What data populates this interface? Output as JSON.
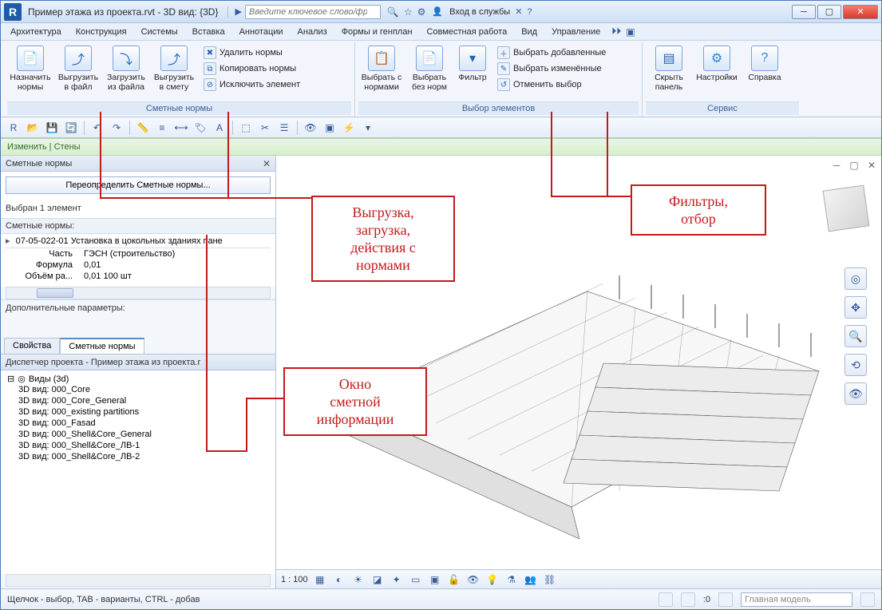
{
  "window": {
    "title": "Пример этажа из проекта.rvt - 3D вид: {3D}",
    "search_placeholder": "Введите ключевое слово/фразу",
    "signin": "Вход в службы"
  },
  "menu": [
    "Архитектура",
    "Конструкция",
    "Системы",
    "Вставка",
    "Аннотации",
    "Анализ",
    "Формы и генплан",
    "Совместная работа",
    "Вид",
    "Управление"
  ],
  "ribbon": {
    "group1": {
      "label": "Сметные нормы",
      "big": [
        {
          "label": "Назначить нормы"
        },
        {
          "label": "Выгрузить в файл"
        },
        {
          "label": "Загрузить из файла"
        },
        {
          "label": "Выгрузить в смету"
        }
      ],
      "small": [
        "Удалить  нормы",
        "Копировать  нормы",
        "Исключить  элемент"
      ]
    },
    "group2": {
      "label": "Выбор элементов",
      "big": [
        {
          "label": "Выбрать с нормами"
        },
        {
          "label": "Выбрать без норм"
        },
        {
          "label": "Фильтр"
        }
      ],
      "small": [
        "Выбрать добавленные",
        "Выбрать изменённые",
        "Отменить выбор"
      ]
    },
    "group3": {
      "label": "Сервис",
      "big": [
        {
          "label": "Скрыть панель"
        },
        {
          "label": "Настройки"
        },
        {
          "label": "Справка"
        }
      ]
    }
  },
  "modifybar": "Изменить | Стены",
  "panel": {
    "title": "Сметные нормы",
    "redefine": "Переопределить Сметные нормы...",
    "selected": "Выбран 1 элемент",
    "norms_header": "Сметные нормы:",
    "norm_title": "07-05-022-01 Установка в цокольных зданиях пане",
    "rows": [
      {
        "k": "Часть",
        "v": "ГЭСН (строительство)"
      },
      {
        "k": "Формула",
        "v": "0,01"
      },
      {
        "k": "Объём ра...",
        "v": "0,01 100 шт"
      }
    ],
    "addparams": "Дополнительные параметры:",
    "tabs": [
      "Свойства",
      "Сметные нормы"
    ]
  },
  "browser": {
    "title": "Диспетчер проекта - Пример этажа из проекта.r",
    "root": "Виды (3d)",
    "items": [
      "3D вид: 000_Core",
      "3D вид: 000_Core_General",
      "3D вид: 000_existing partitions",
      "3D вид: 000_Fasad",
      "3D вид: 000_Shell&Core_General",
      "3D вид: 000_Shell&Core_ЛВ-1",
      "3D вид: 000_Shell&Core_ЛВ-2"
    ]
  },
  "viewctl": {
    "scale": "1 : 100"
  },
  "status": {
    "hint": "Щелчок - выбор, TAB - варианты, CTRL - добав",
    "zero": ":0",
    "model_filter": "Главная модель"
  },
  "annotations": {
    "a1": "Выгрузка,\nзагрузка,\nдействия с\nнормами",
    "a2": "Фильтры,\nотбор",
    "a3": "Окно\nсметной\nинформации"
  }
}
